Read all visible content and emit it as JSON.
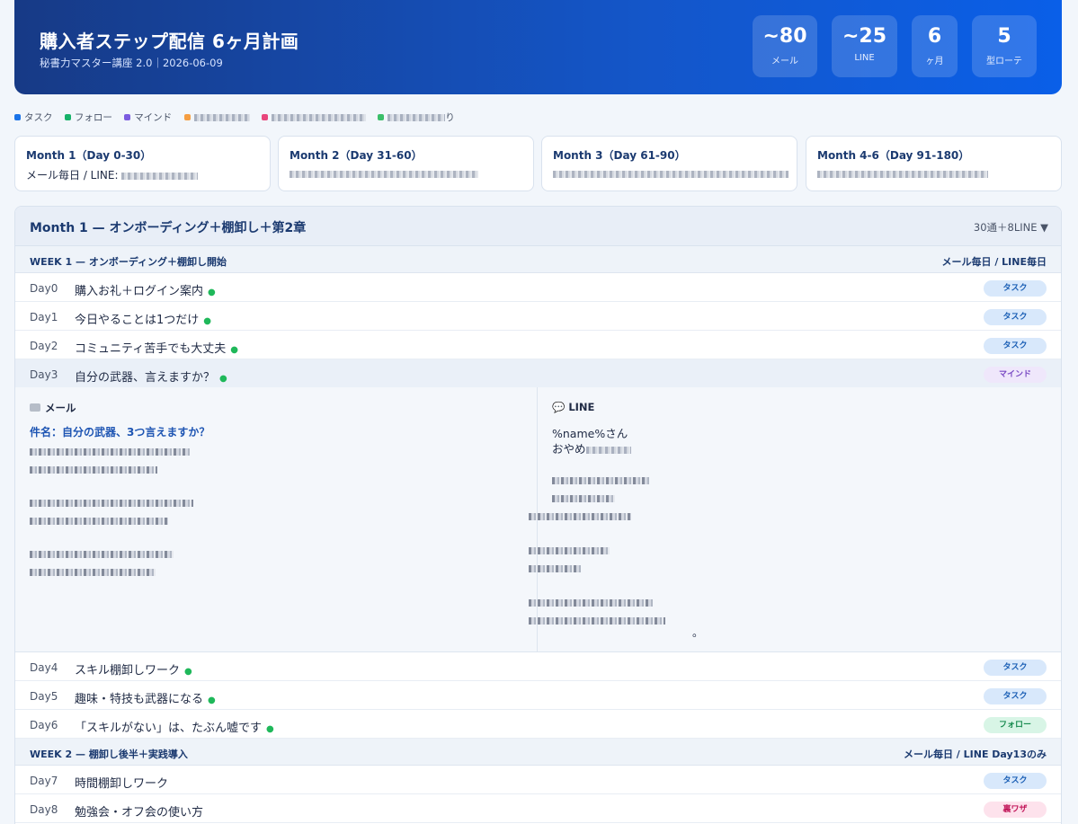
{
  "header": {
    "title": "購入者ステップ配信 6ヶ月計画",
    "subtitle": "秘書力マスター講座 2.0｜2026-06-09",
    "stats": [
      {
        "value": "~80",
        "label": "メール"
      },
      {
        "value": "~25",
        "label": "LINE"
      },
      {
        "value": "6",
        "label": "ヶ月"
      },
      {
        "value": "5",
        "label": "型ローテ"
      }
    ]
  },
  "legend": [
    {
      "label": "タスク",
      "color": "#1a73e8"
    },
    {
      "label": "フォロー",
      "color": "#17b26a"
    },
    {
      "label": "マインド",
      "color": "#7c5ce0"
    },
    {
      "label": "",
      "color": "#f59e42"
    },
    {
      "label": "",
      "color": "#e8467c"
    },
    {
      "label": "り",
      "color": "#3bbf6a"
    }
  ],
  "months": [
    {
      "title": "Month 1（Day 0-30）",
      "desc": "メール毎日 / LINE: "
    },
    {
      "title": "Month 2（Day 31-60）",
      "desc": ""
    },
    {
      "title": "Month 3（Day 61-90）",
      "desc": ""
    },
    {
      "title": "Month 4-6（Day 91-180）",
      "desc": ""
    }
  ],
  "panel": {
    "title": "Month 1 — オンボーディング＋棚卸し＋第2章",
    "count": "30通＋8LINE ▼"
  },
  "weeks": [
    {
      "title": "WEEK 1 — オンボーディング＋棚卸し開始",
      "right": "メール毎日 / LINE毎日"
    },
    {
      "title": "WEEK 2 — 棚卸し後半＋実践導入",
      "right": "メール毎日 / LINE Day13のみ"
    }
  ],
  "rows": [
    {
      "day": "Day0",
      "title": "購入お礼＋ログイン案内",
      "sent": "●",
      "tag": "タスク"
    },
    {
      "day": "Day1",
      "title": "今日やることは1つだけ",
      "sent": "●",
      "tag": "タスク"
    },
    {
      "day": "Day2",
      "title": "コミュニティ苦手でも大丈夫",
      "sent": "●",
      "tag": "タスク"
    },
    {
      "day": "Day3",
      "title": "自分の武器、言えますか？",
      "sent": "●",
      "tag": "マインド"
    },
    {
      "day": "Day4",
      "title": "スキル棚卸しワーク",
      "sent": "●",
      "tag": "タスク"
    },
    {
      "day": "Day5",
      "title": "趣味・特技も武器になる",
      "sent": "●",
      "tag": "タスク"
    },
    {
      "day": "Day6",
      "title": "「スキルがない」は、たぶん嘘です",
      "sent": "●",
      "tag": "フォロー"
    },
    {
      "day": "Day7",
      "title": "時間棚卸しワーク",
      "sent": "",
      "tag": "タスク"
    },
    {
      "day": "Day8",
      "title": "勉強会・オフ会の使い方",
      "sent": "",
      "tag": "裏ワザ"
    }
  ],
  "detail": {
    "mail_heading": "メール",
    "subject": "件名：自分の武器、3つ言えますか？",
    "line_heading": "💬 LINE",
    "line_greeting": "%name%さん",
    "line_second": "おやめ",
    "line_end": "。"
  }
}
